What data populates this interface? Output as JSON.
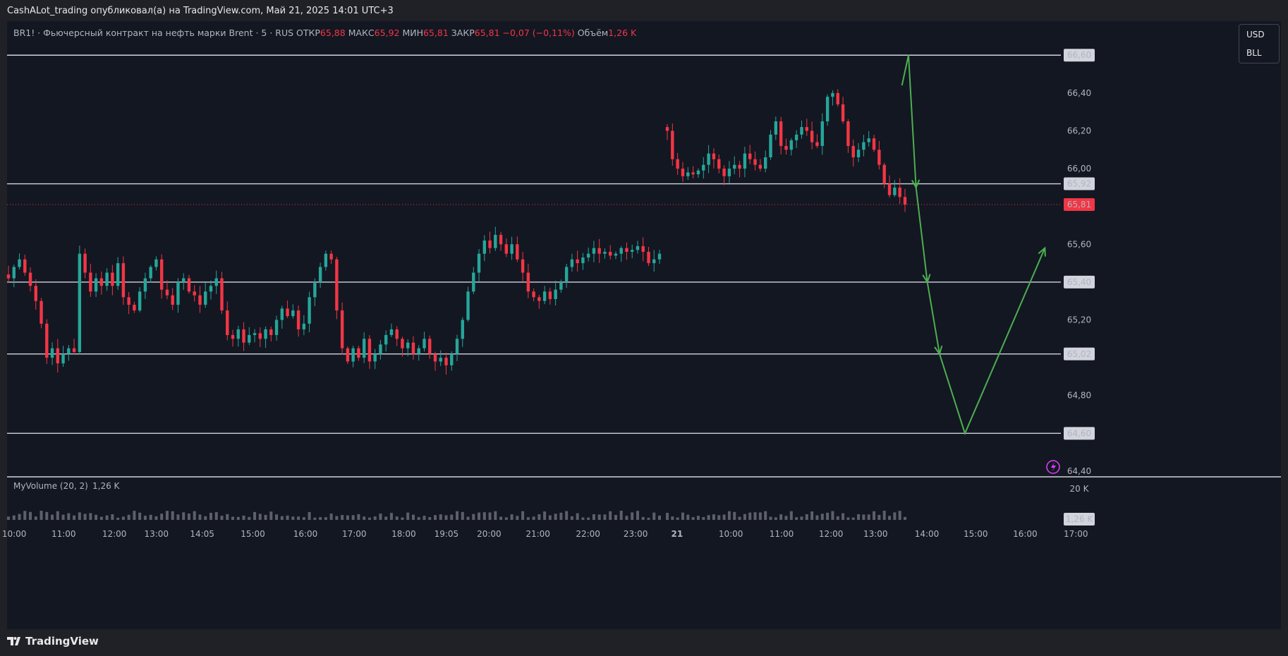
{
  "publisher_line": "CashALot_trading опубликовал(а) на TradingView.com, Май 21, 2025 14:01 UTC+3",
  "legend": {
    "symbol": "BR1! · Фьючерсный контракт на нефть марки Brent · 5 · RUS",
    "open_label": "ОТКР",
    "open": "65,88",
    "high_label": "МАКС",
    "high": "65,92",
    "low_label": "МИН",
    "low": "65,81",
    "close_label": "ЗАКР",
    "close": "65,81",
    "change": "−0,07 (−0,11%)",
    "volume_label": "Объём",
    "volume": "1,26 K"
  },
  "unit_selector": {
    "currency": "USD",
    "unit": "BLL"
  },
  "volume_pane": {
    "label": "MyVolume (20, 2)",
    "value": "1,26 K",
    "axis_top": "20 K",
    "current": "1,26 K"
  },
  "brand": {
    "icon": "tradingview-logo-icon",
    "name": "TradingView"
  },
  "colors": {
    "up": "#26a69a",
    "down": "#f23645",
    "level": "#d1d4dc",
    "forecast": "#4caf50",
    "background": "#131722"
  },
  "chart_data": {
    "type": "candlestick",
    "x_ticks": [
      "10:00",
      "11:00",
      "12:00",
      "13:00",
      "14:05",
      "15:00",
      "16:00",
      "17:00",
      "18:00",
      "19:05",
      "20:00",
      "21:00",
      "22:00",
      "23:00",
      "21",
      "10:00",
      "11:00",
      "12:00",
      "13:00",
      "14:00",
      "15:00",
      "16:00",
      "17:00"
    ],
    "y_ticks": [
      "66,60",
      "66,40",
      "66,20",
      "66,00",
      "65,92",
      "65,81",
      "65,60",
      "65,40",
      "65,20",
      "65,02",
      "64,80",
      "64,60",
      "64,40"
    ],
    "ylim": [
      64.37,
      66.78
    ],
    "horizontal_levels": [
      66.6,
      65.92,
      65.4,
      65.02,
      64.6
    ],
    "last_price": 65.81,
    "session1_closes": [
      65.42,
      65.48,
      65.52,
      65.45,
      65.38,
      65.3,
      65.18,
      65.0,
      65.05,
      64.97,
      65.02,
      65.05,
      65.03,
      65.55,
      65.45,
      65.35,
      65.42,
      65.38,
      65.45,
      65.38,
      65.5,
      65.32,
      65.28,
      65.25,
      65.35,
      65.42,
      65.48,
      65.52,
      65.36,
      65.33,
      65.28,
      65.4,
      65.42,
      65.35,
      65.33,
      65.28,
      65.35,
      65.38,
      65.42,
      65.25,
      65.12,
      65.1,
      65.15,
      65.08,
      65.12,
      65.13,
      65.1,
      65.15,
      65.12,
      65.2,
      65.26,
      65.22,
      65.25,
      65.15,
      65.18,
      65.32,
      65.4,
      65.48,
      65.55,
      65.52,
      65.25,
      65.05,
      64.98,
      65.05,
      65.0,
      65.1,
      64.98,
      65.02,
      65.07,
      65.12,
      65.15,
      65.1,
      65.05,
      65.08,
      65.02,
      65.05,
      65.1,
      65.02,
      64.98,
      65.0,
      64.96,
      65.02,
      65.1,
      65.2,
      65.35,
      65.45,
      65.55,
      65.62,
      65.58,
      65.65,
      65.6,
      65.55,
      65.6,
      65.52,
      65.45,
      65.35,
      65.32,
      65.3,
      65.35,
      65.31,
      65.36,
      65.4,
      65.48,
      65.52,
      65.5,
      65.53,
      65.55,
      65.58,
      65.55,
      65.56,
      65.54,
      65.55,
      65.58,
      65.56,
      65.57,
      65.59,
      65.56,
      65.5,
      65.52,
      65.55
    ],
    "session2_closes": [
      66.2,
      66.05,
      66.0,
      65.96,
      65.98,
      65.97,
      65.99,
      66.02,
      66.08,
      66.05,
      66.0,
      65.96,
      66.0,
      66.02,
      66.0,
      66.08,
      66.05,
      66.02,
      66.0,
      66.06,
      66.18,
      66.25,
      66.12,
      66.1,
      66.15,
      66.18,
      66.22,
      66.2,
      66.14,
      66.12,
      66.25,
      66.38,
      66.4,
      66.34,
      66.25,
      66.12,
      66.06,
      66.1,
      66.14,
      66.16,
      66.1,
      66.02,
      65.92,
      65.86,
      65.9,
      65.85,
      65.81
    ],
    "forecast_path": [
      {
        "time": "13:53",
        "price": 66.44
      },
      {
        "time": "14:00",
        "price": 66.6
      },
      {
        "time": "14:08",
        "price": 65.9
      },
      {
        "time": "14:20",
        "price": 65.4
      },
      {
        "time": "14:33",
        "price": 65.02
      },
      {
        "time": "15:00",
        "price": 64.6
      },
      {
        "time": "16:25",
        "price": 65.58
      }
    ]
  }
}
